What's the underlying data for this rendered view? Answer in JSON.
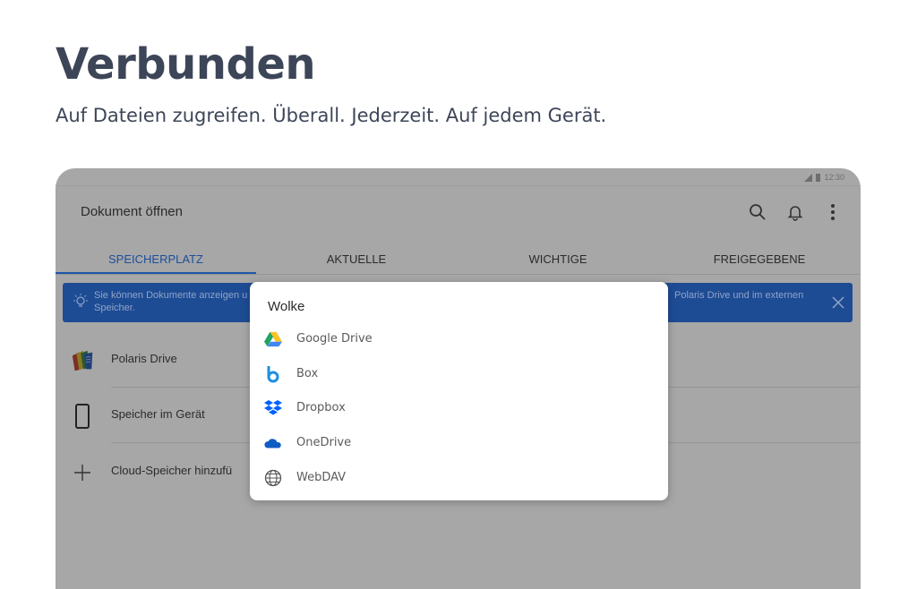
{
  "hero": {
    "headline": "Verbunden",
    "subline": "Auf Dateien zugreifen. Überall. Jederzeit. Auf jedem Gerät."
  },
  "status_bar": {
    "time": "12:30"
  },
  "app": {
    "title": "Dokument öffnen",
    "toolbar_icons": [
      "search-icon",
      "bell-icon",
      "more-vert-icon"
    ],
    "tabs": [
      {
        "label": "SPEICHERPLATZ",
        "active": true
      },
      {
        "label": "AKTUELLE",
        "active": false
      },
      {
        "label": "WICHTIGE",
        "active": false
      },
      {
        "label": "FREIGEGEBENE",
        "active": false
      }
    ],
    "banner": {
      "line1_start": "Sie können Dokumente anzeigen u",
      "line2": "Speicher.",
      "line1_end": "Polaris Drive und im externen"
    },
    "storage_items": [
      {
        "label": "Polaris Drive",
        "icon": "polaris-drive-icon"
      },
      {
        "label": "Speicher im Gerät",
        "icon": "device-icon"
      },
      {
        "label": "Cloud-Speicher hinzufü",
        "icon": "plus-icon"
      }
    ]
  },
  "dialog": {
    "title": "Wolke",
    "options": [
      {
        "label": "Google Drive",
        "icon": "google-drive-icon"
      },
      {
        "label": "Box",
        "icon": "box-icon"
      },
      {
        "label": "Dropbox",
        "icon": "dropbox-icon"
      },
      {
        "label": "OneDrive",
        "icon": "onedrive-icon"
      },
      {
        "label": "WebDAV",
        "icon": "globe-icon"
      }
    ]
  },
  "colors": {
    "headline": "#3d4658",
    "overlay_gray": "#a7a7a7",
    "banner": "#1e4c94",
    "tab_active": "#1d4f9c"
  }
}
